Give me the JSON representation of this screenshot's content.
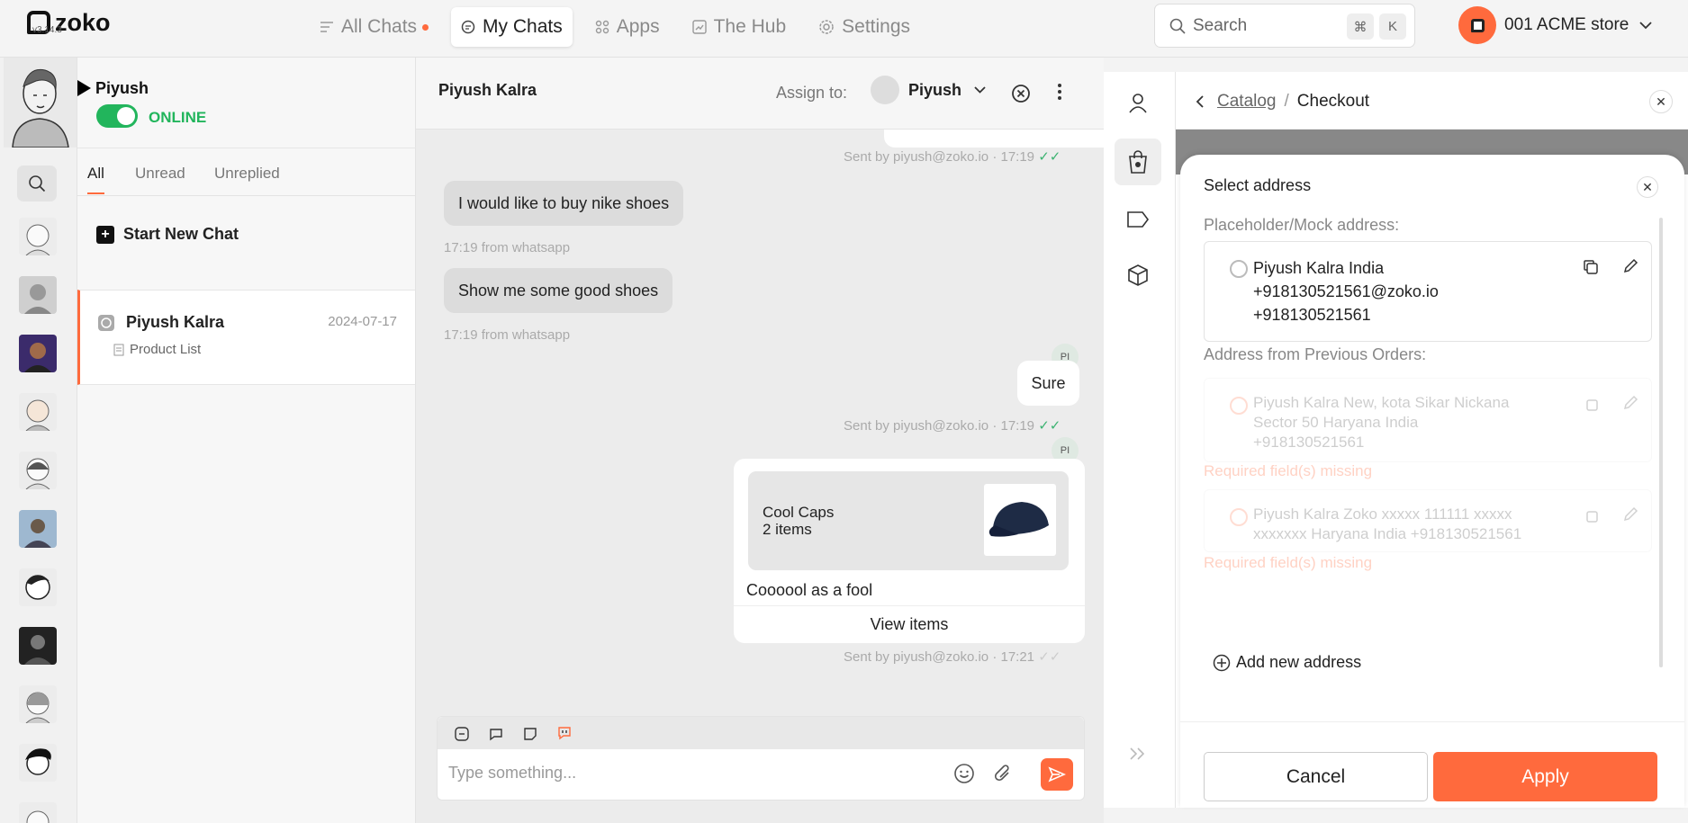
{
  "app": {
    "name": "zoko",
    "version": "v3.14.3"
  },
  "nav": [
    {
      "label": "All Chats",
      "has_dot": true
    },
    {
      "label": "My Chats",
      "active": true
    },
    {
      "label": "Apps"
    },
    {
      "label": "The Hub"
    },
    {
      "label": "Settings"
    }
  ],
  "search": {
    "placeholder": "Search",
    "key1": "⌘",
    "key2": "K"
  },
  "store": {
    "name": "001 ACME store"
  },
  "agent": {
    "name": "Piyush",
    "status": "ONLINE"
  },
  "tabs": [
    {
      "label": "All",
      "active": true
    },
    {
      "label": "Unread"
    },
    {
      "label": "Unreplied"
    }
  ],
  "start_chat_label": "Start New Chat",
  "chat_list": [
    {
      "name": "Piyush Kalra",
      "date": "2024-07-17",
      "preview": "Product List"
    }
  ],
  "conversation": {
    "title": "Piyush Kalra",
    "assign_label": "Assign to:",
    "assignee": "Piyush",
    "messages": [
      {
        "meta": "Sent by piyush@zoko.io · 17:19"
      },
      {
        "text": "I would like to buy nike shoes",
        "meta": "17:19 from whatsapp"
      },
      {
        "text": "Show me some good shoes",
        "meta": "17:19 from whatsapp"
      },
      {
        "text": "Sure",
        "avatar": "PI",
        "meta": "Sent by piyush@zoko.io · 17:19"
      },
      {
        "avatar": "PI",
        "product_title": "Cool Caps",
        "product_count": "2 items",
        "caption": "Coooool as a fool",
        "action": "View items",
        "meta": "Sent by piyush@zoko.io · 17:21"
      }
    ],
    "composer_placeholder": "Type something..."
  },
  "panel": {
    "breadcrumb_parent": "Catalog",
    "breadcrumb_current": "Checkout",
    "sheet_title": "Select address",
    "mock_label": "Placeholder/Mock address:",
    "mock_address": {
      "line1": "Piyush Kalra India",
      "line2": "+918130521561@zoko.io",
      "line3": "+918130521561"
    },
    "prev_label": "Address from Previous Orders:",
    "prev_addresses": [
      {
        "line1": "Piyush Kalra New, kota Sikar Nickana",
        "line2": "Sector 50 Haryana India",
        "line3": "+918130521561",
        "error": "Required field(s) missing"
      },
      {
        "line1": "Piyush Kalra Zoko xxxxx 111111 xxxxx",
        "line2": "xxxxxxx Haryana India +918130521561",
        "error": "Required field(s) missing"
      }
    ],
    "add_new_label": "Add new address",
    "cancel_label": "Cancel",
    "apply_label": "Apply"
  },
  "colors": {
    "accent": "#ff6a3d",
    "online": "#22b55c"
  }
}
